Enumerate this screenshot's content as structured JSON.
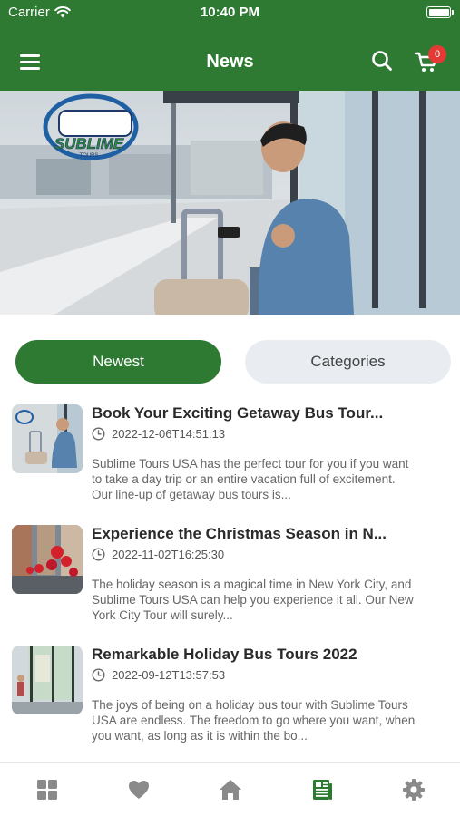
{
  "status_bar": {
    "carrier": "Carrier",
    "time": "10:40 PM"
  },
  "header": {
    "title": "News",
    "cart_count": "0",
    "brand_color": "#2f7a33"
  },
  "hero": {
    "logo_text": "SUBLIME",
    "logo_subtext": "TOURS"
  },
  "tabs": [
    {
      "label": "Newest",
      "active": true
    },
    {
      "label": "Categories",
      "active": false
    }
  ],
  "articles": [
    {
      "title": "Book Your Exciting Getaway Bus Tour...",
      "date": "2022-12-06T14:51:13",
      "excerpt": "Sublime Tours USA has the perfect tour for you if you want to take a day trip or an entire vacation full of excitement. Our line-up of getaway bus tours is..."
    },
    {
      "title": "Experience the Christmas Season in N...",
      "date": "2022-11-02T16:25:30",
      "excerpt": "The holiday season is a magical time in New York City, and Sublime Tours USA can help you experience it all. Our New York City Tour will surely..."
    },
    {
      "title": "Remarkable Holiday Bus Tours 2022",
      "date": "2022-09-12T13:57:53",
      "excerpt": "The joys of being on a holiday bus tour with Sublime Tours USA are endless. The freedom to go where you want, when you want, as long as it is within the bo..."
    }
  ],
  "bottom_nav": [
    {
      "icon": "grid-icon",
      "active": false
    },
    {
      "icon": "heart-icon",
      "active": false
    },
    {
      "icon": "home-icon",
      "active": false
    },
    {
      "icon": "news-icon",
      "active": true
    },
    {
      "icon": "gear-icon",
      "active": false
    }
  ]
}
